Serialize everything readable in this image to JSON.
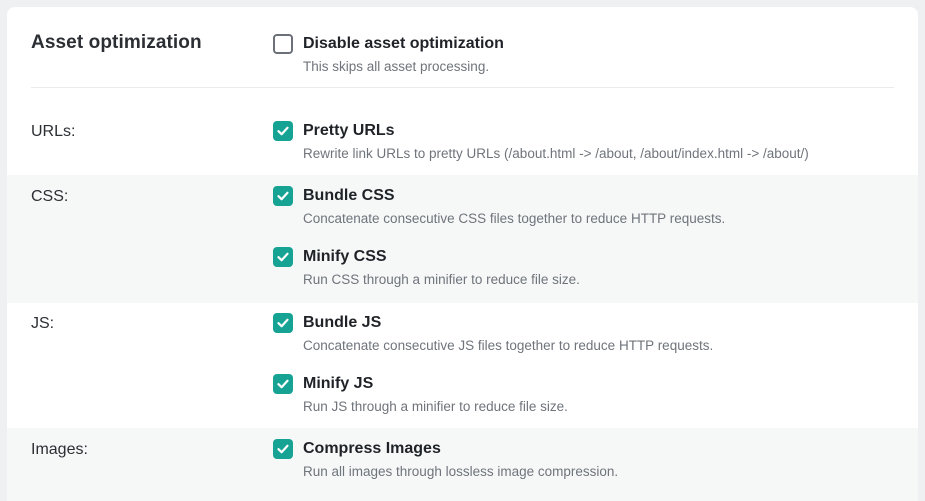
{
  "section": {
    "title": "Asset optimization",
    "disable": {
      "label": "Disable asset optimization",
      "description": "This skips all asset processing.",
      "checked": false
    }
  },
  "groups": [
    {
      "label": "URLs:",
      "options": [
        {
          "label": "Pretty URLs",
          "description": "Rewrite link URLs to pretty URLs (/about.html -> /about, /about/index.html -> /about/)",
          "checked": true
        }
      ]
    },
    {
      "label": "CSS:",
      "options": [
        {
          "label": "Bundle CSS",
          "description": "Concatenate consecutive CSS files together to reduce HTTP requests.",
          "checked": true
        },
        {
          "label": "Minify CSS",
          "description": "Run CSS through a minifier to reduce file size.",
          "checked": true
        }
      ]
    },
    {
      "label": "JS:",
      "options": [
        {
          "label": "Bundle JS",
          "description": "Concatenate consecutive JS files together to reduce HTTP requests.",
          "checked": true
        },
        {
          "label": "Minify JS",
          "description": "Run JS through a minifier to reduce file size.",
          "checked": true
        }
      ]
    },
    {
      "label": "Images:",
      "options": [
        {
          "label": "Compress Images",
          "description": "Run all images through lossless image compression.",
          "checked": true
        }
      ]
    }
  ],
  "colors": {
    "accent": "#16a394",
    "alt_row": "#f6f8f8"
  }
}
